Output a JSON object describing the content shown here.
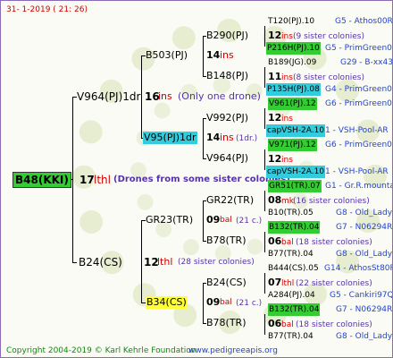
{
  "header": {
    "date_text": "31-   1-2019  (  21:  26)"
  },
  "footer": {
    "copyright": "Copyright 2004-2019 © Karl Kehrle Foundation",
    "site": "www.pedigreeapis.org"
  },
  "root": {
    "name": "B48(KKI)",
    "num": "17",
    "mating": "lthl",
    "note": "(Drones from some sister colonies)"
  },
  "gen1": [
    {
      "name": "V964(PJ)1dr",
      "num": "16",
      "mating": "ins",
      "note": "(Only one drone)"
    },
    {
      "name": "B24(CS)",
      "num": "12",
      "mating": "lthl",
      "note": "(28 sister colonies)"
    }
  ],
  "gen2": [
    {
      "name": "B503(PJ)",
      "num": "14",
      "mating": "ins",
      "note": ""
    },
    {
      "name": "V95(PJ)1dr",
      "num": "14",
      "mating": "ins",
      "note": "(1dr.)"
    },
    {
      "name": "GR23(TR)",
      "num": "09",
      "mating": "bal",
      "note": "(21 c.)"
    },
    {
      "name": "B34(CS)",
      "num": "09",
      "mating": "bal",
      "note": "(21 c.)"
    }
  ],
  "gen3": [
    {
      "name": "B290(PJ)",
      "num": "12",
      "mating": "ins",
      "note": "(9 sister colonies)"
    },
    {
      "name": "B148(PJ)",
      "num": "11",
      "mating": "ins",
      "note": "(8 sister colonies)"
    },
    {
      "name": "V992(PJ)",
      "num": "12",
      "mating": "ins",
      "note": ""
    },
    {
      "name": "V964(PJ)",
      "num": "12",
      "mating": "ins",
      "note": ""
    },
    {
      "name": "GR22(TR)",
      "num": "08",
      "mating": "mk",
      "note": "(16 sister colonies)"
    },
    {
      "name": "B78(TR)",
      "num": "06",
      "mating": "bal",
      "note": "(18 sister colonies)"
    },
    {
      "name": "B24(CS)",
      "num": "07",
      "mating": "lthl",
      "note": "(22 sister colonies)"
    },
    {
      "name": "B78(TR)",
      "num": "06",
      "mating": "bal",
      "note": "(18 sister colonies)"
    }
  ],
  "gen4": [
    {
      "name": "T120(PJ).10",
      "tag": "G5 - Athos00R"
    },
    {
      "name": "P216H(PJ).10",
      "tag": "G5 - PrimGreen00"
    },
    {
      "name": "B189(JG).09",
      "tag": "G29 - B-xx43"
    },
    {
      "name": "P135H(PJ).08",
      "tag": "G4 - PrimGreen00"
    },
    {
      "name": "V961(PJ).12",
      "tag": "G6 - PrimGreen00"
    },
    {
      "name": "capVSH-2A.10",
      "tag": "1 - VSH-Pool-AR"
    },
    {
      "name": "V971(PJ).12",
      "tag": "G6 - PrimGreen00"
    },
    {
      "name": "capVSH-2A.10",
      "tag": "1 - VSH-Pool-AR"
    },
    {
      "name": "GR51(TR).07",
      "tag": "G1 - Gr.R.mounta"
    },
    {
      "name": "B10(TR).05",
      "tag": "G8 - Old_Lady"
    },
    {
      "name": "B132(TR).04",
      "tag": "G7 - N06294R"
    },
    {
      "name": "B77(TR).04",
      "tag": "G8 - Old_Lady"
    },
    {
      "name": "B444(CS).05",
      "tag": "G14 - AthosSt80R"
    },
    {
      "name": "A284(PJ).04",
      "tag": "G5 - Cankiri97Q"
    },
    {
      "name": "B132(TR).04",
      "tag": "G7 - N06294R"
    },
    {
      "name": "B77(TR).04",
      "tag": "G8 - Old_Lady"
    }
  ],
  "colors": {
    "green": "#33cc33",
    "cyan": "#33ccdd",
    "yellow": "#ffff33",
    "blue": "#2244cc",
    "purple": "#5533aa",
    "red": "#cc0000"
  }
}
